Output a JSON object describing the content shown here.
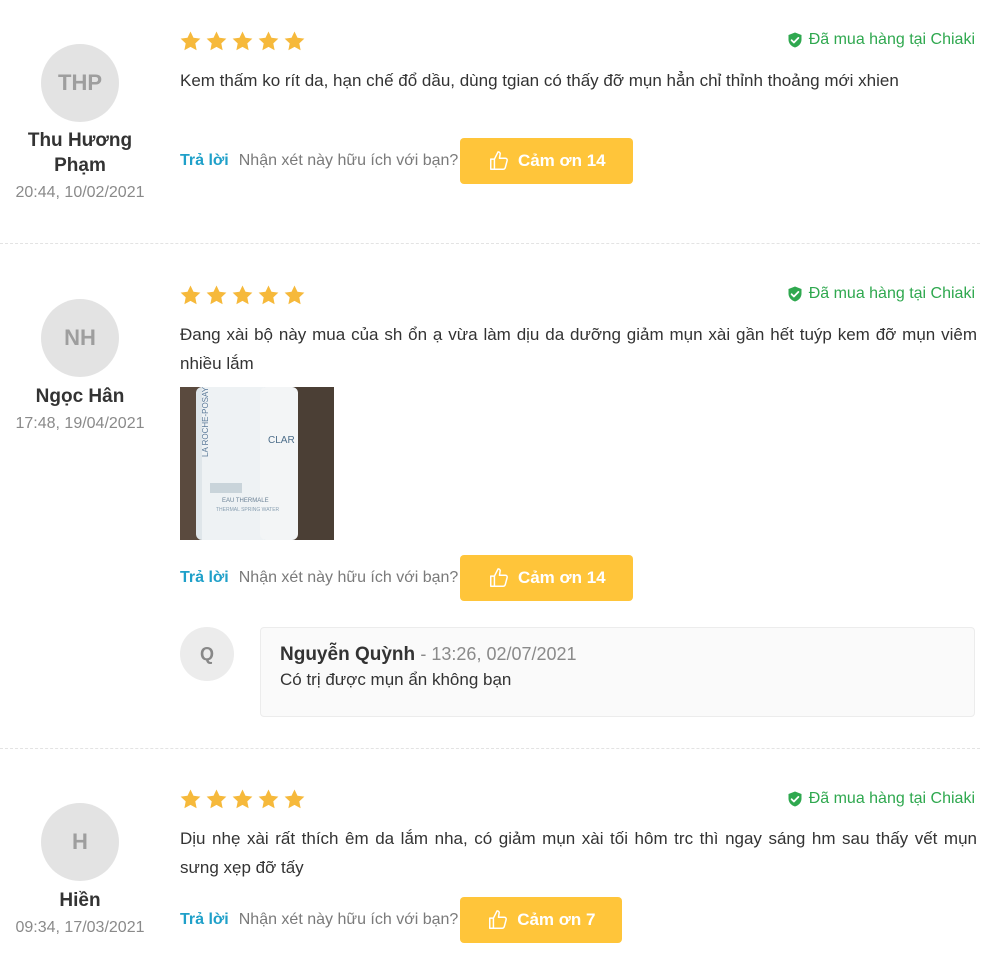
{
  "reviews": [
    {
      "initials": "THP",
      "name": "Thu Hương Phạm",
      "time": "20:44, 10/02/2021",
      "rating": 5,
      "verified_label": "Đã mua hàng tại Chiaki",
      "content": "Kem thấm ko rít da, hạn chế đổ dầu, dùng tgian có thấy đỡ mụn hẳn chỉ thỉnh thoảng mới xhien",
      "reply_label": "Trả lời",
      "helpful_question": "Nhận xét này hữu ích với bạn?",
      "thanks_label": "Cảm ơn 14"
    },
    {
      "initials": "NH",
      "name": "Ngọc Hân",
      "time": "17:48, 19/04/2021",
      "rating": 5,
      "verified_label": "Đã mua hàng tại Chiaki",
      "content": "Đang xài bộ này mua của sh ổn ạ vừa làm dịu da dưỡng giảm mụn xài gần hết tuýp kem đỡ mụn viêm nhiều lắm",
      "photo_texts": [
        "LA ROCHE-POSAY",
        "EAU THERMALE",
        "THERMAL SPRING WATER",
        "CLAR"
      ],
      "reply_label": "Trả lời",
      "helpful_question": "Nhận xét này hữu ích với bạn?",
      "thanks_label": "Cảm ơn 14",
      "replies": [
        {
          "avatar_initial": "Q",
          "name": "Nguyễn Quỳnh",
          "time": "- 13:26, 02/07/2021",
          "text": "Có trị được mụn ẩn không bạn"
        }
      ]
    },
    {
      "initials": "H",
      "name": "Hiền",
      "time": "09:34, 17/03/2021",
      "rating": 5,
      "verified_label": "Đã mua hàng tại Chiaki",
      "content": "Dịu nhẹ xài rất thích êm da lắm nha, có giảm mụn xài tối hôm trc thì ngay sáng hm sau thấy vết mụn sưng xẹp đỡ tấy",
      "reply_label": "Trả lời",
      "helpful_question": "Nhận xét này hữu ích với bạn?",
      "thanks_label": "Cảm ơn 7"
    }
  ],
  "colors": {
    "star": "#f6b93b",
    "verified": "#2fa84f",
    "reply_link": "#1fa0c9",
    "thanks_button": "#ffc53a"
  },
  "icons": {
    "star": "star-icon",
    "verified": "check-shield-icon",
    "thanks": "thumbs-up-icon"
  }
}
